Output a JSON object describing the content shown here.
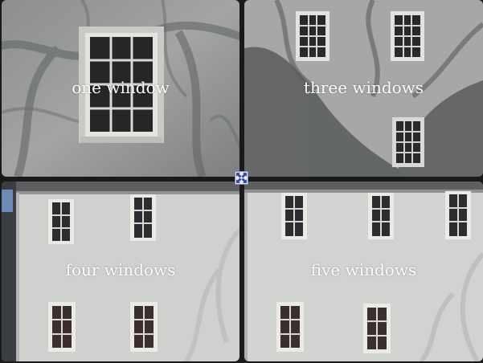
{
  "tiles": [
    {
      "caption": "one window"
    },
    {
      "caption": "three windows"
    },
    {
      "caption": "four windows"
    },
    {
      "caption": "five windows"
    }
  ],
  "colors": {
    "wall_light": "#cfd0ce",
    "wall_shade": "#9a9c9b",
    "window_frame": "#e9e9e6",
    "window_glass": "#2a2a2c",
    "button_icon": "#2f4aa8"
  },
  "icons": {
    "expand": "expand-arrows-icon"
  }
}
